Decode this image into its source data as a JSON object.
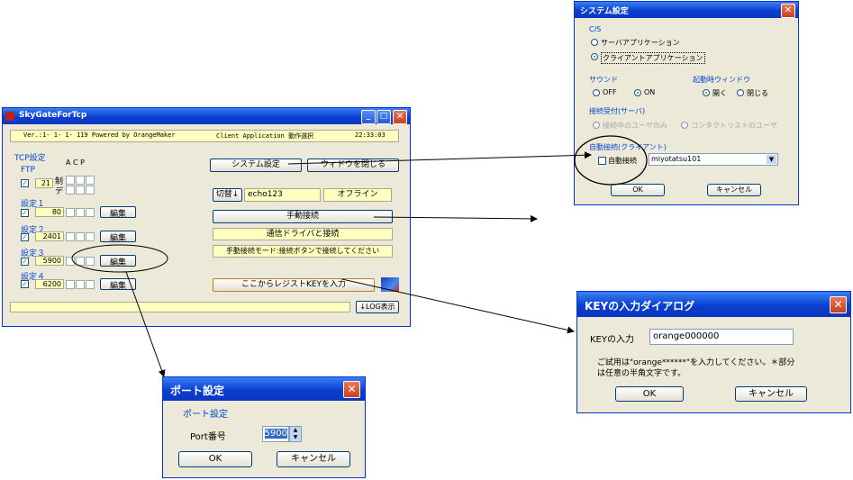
{
  "main": {
    "title": "SkyGateForTcp",
    "status": {
      "version": "Ver.:1- 1- 1- 119  Powered by OrangeMaker",
      "mode": "Client Application 動作選択",
      "time": "22:33:03"
    },
    "tcp_group": "TCP設定",
    "ftp_label": "FTP",
    "ftp_sub1": "制",
    "ftp_sub2": "デ",
    "col_headers": "A C P",
    "ftp_port": "21",
    "settings": [
      {
        "label": "設定１",
        "port": "80",
        "edit": "編集"
      },
      {
        "label": "設定２",
        "port": "2401",
        "edit": "編集"
      },
      {
        "label": "設定３",
        "port": "5900",
        "edit": "編集"
      },
      {
        "label": "設定４",
        "port": "6200",
        "edit": "編集"
      }
    ],
    "system_settings_button": "システム設定",
    "close_window_button": "ウィドウを閉じる",
    "switch_button": "切替↓",
    "connection_name": "echo123",
    "offline": "オフライン",
    "manual_connect_button": "手動接続",
    "driver_message": "通信ドライバと接続",
    "mode_message": "手動接続モード:接続ボタンで接続してください",
    "register_key_button": "ここからレジストKEYを入力",
    "log_button": "↓LOG表示"
  },
  "system_dialog": {
    "title": "システム設定",
    "cs_group": "C/S",
    "cs_options": [
      "サーバアプリケーション",
      "クライアントアプリケーション"
    ],
    "sound_group": "サウンド",
    "sound_options": [
      "OFF",
      "ON"
    ],
    "startup_group": "起動時ウィンドウ",
    "startup_options": [
      "開く",
      "閉じる"
    ],
    "accept_group": "接続受付(サーバ)",
    "accept_options": [
      "接続中のユーザのみ",
      "コンタクトリストのユーザ"
    ],
    "auto_group": "自動接続(クライアント)",
    "auto_checkbox": "自動接続",
    "auto_user": "miyotatsu101",
    "ok": "OK",
    "cancel": "キャンセル"
  },
  "port_dialog": {
    "title": "ポート設定",
    "group": "ポート設定",
    "port_label": "Port番号",
    "port_value": "5900",
    "ok": "OK",
    "cancel": "キャンセル"
  },
  "key_dialog": {
    "title": "KEYの入力ダイアログ",
    "key_label": "KEYの入力",
    "key_value": "orange000000",
    "note_line1": "ご試用は\"orange******\"を入力してください。＊部分",
    "note_line2": "は任意の半角文字です。",
    "ok": "OK",
    "cancel": "キャンセル"
  },
  "colors": {
    "title_blue": "#0a3fd0",
    "window_bg": "#ece9d8",
    "status_yellow": "#ffffc0",
    "close_red": "#d8502a"
  }
}
